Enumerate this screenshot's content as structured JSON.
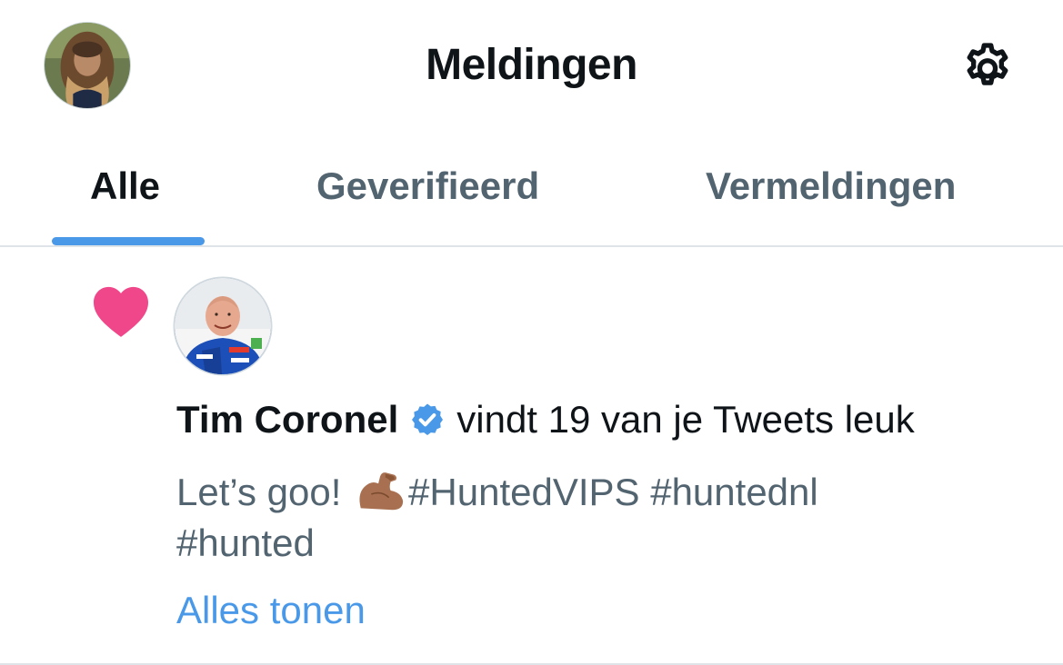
{
  "header": {
    "title": "Meldingen"
  },
  "tabs": [
    {
      "label": "Alle",
      "active": true
    },
    {
      "label": "Geverifieerd",
      "active": false
    },
    {
      "label": "Vermeldingen",
      "active": false
    }
  ],
  "notification": {
    "type_icon": "heart-icon",
    "user_name": "Tim Coronel",
    "verified": true,
    "action_text": "vindt 19 van je Tweets leuk",
    "tweet_text_before": "Let’s goo!",
    "tweet_emoji": "💪🏽",
    "tweet_text_after": "#HuntedVIPS #huntednl",
    "tweet_text_line2": "#hunted",
    "show_all": "Alles tonen"
  },
  "colors": {
    "accent": "#4a99e9",
    "heart": "#f0468a",
    "secondary_text": "#536471",
    "primary_text": "#0f1419",
    "divider": "#dfe4e8"
  }
}
